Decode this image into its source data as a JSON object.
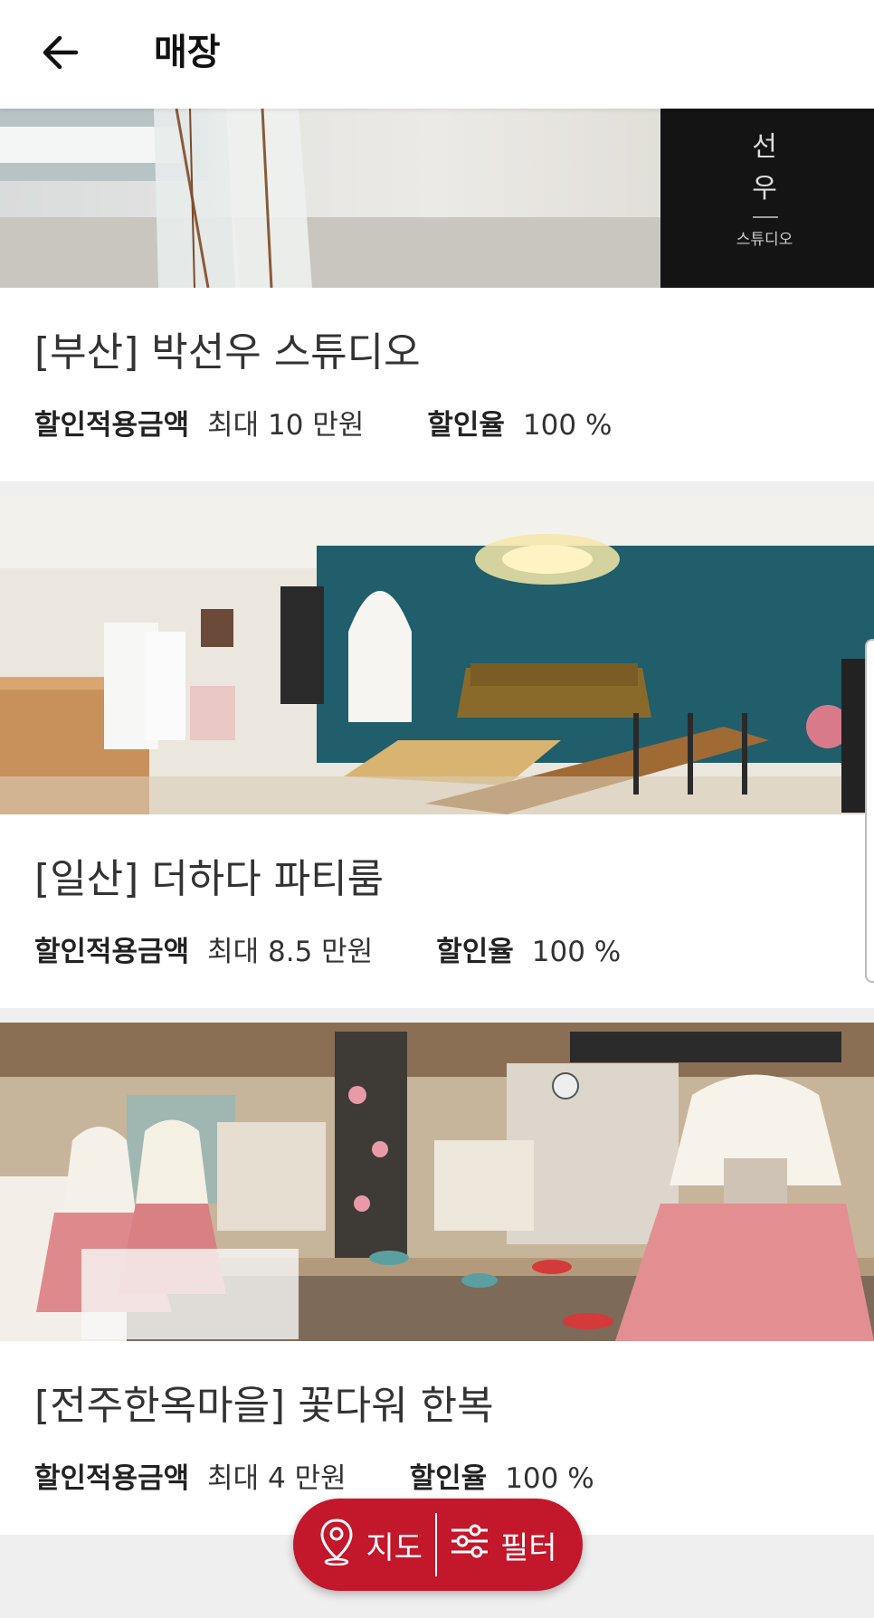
{
  "header": {
    "title": "매장",
    "back_icon": "arrow-left-icon"
  },
  "stores": [
    {
      "image_text": "선\n우\n스튜디오",
      "title": "[부산] 박선우 스튜디오",
      "discount_amount_label": "할인적용금액",
      "discount_amount_value": "최대 10 만원",
      "discount_rate_label": "할인율",
      "discount_rate_value": "100 %"
    },
    {
      "title": "[일산] 더하다 파티룸",
      "discount_amount_label": "할인적용금액",
      "discount_amount_value": "최대 8.5 만원",
      "discount_rate_label": "할인율",
      "discount_rate_value": "100 %"
    },
    {
      "title": "[전주한옥마을] 꽃다워 한복",
      "discount_amount_label": "할인적용금액",
      "discount_amount_value": "최대 4 만원",
      "discount_rate_label": "할인율",
      "discount_rate_value": "100 %"
    }
  ],
  "fab": {
    "map_label": "지도",
    "map_icon": "map-pin-icon",
    "filter_label": "필터",
    "filter_icon": "sliders-icon"
  },
  "colors": {
    "accent": "#c3172b",
    "background": "#efefef"
  }
}
